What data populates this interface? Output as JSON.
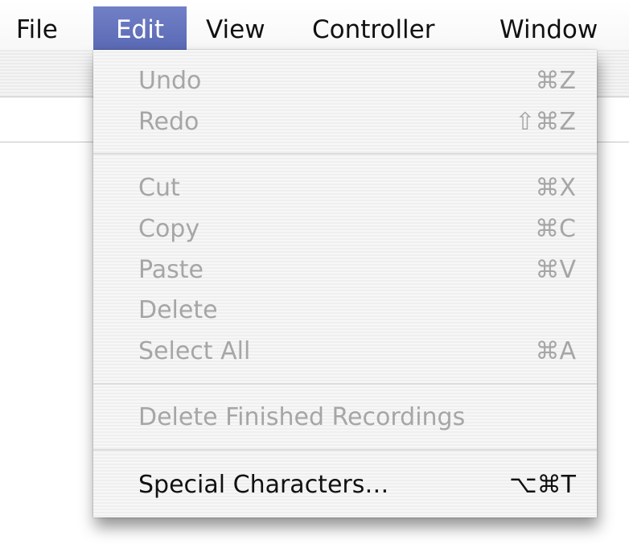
{
  "menubar": {
    "items": [
      {
        "label": "File"
      },
      {
        "label": "Edit"
      },
      {
        "label": "View"
      },
      {
        "label": "Controller"
      },
      {
        "label": "Window"
      }
    ],
    "selected": "Edit"
  },
  "edit_menu": {
    "items": [
      {
        "label": "Undo",
        "shortcut": "⌘Z",
        "enabled": false
      },
      {
        "label": "Redo",
        "shortcut": "⇧⌘Z",
        "enabled": false
      },
      {
        "label": "Cut",
        "shortcut": "⌘X",
        "enabled": false
      },
      {
        "label": "Copy",
        "shortcut": "⌘C",
        "enabled": false
      },
      {
        "label": "Paste",
        "shortcut": "⌘V",
        "enabled": false
      },
      {
        "label": "Delete",
        "shortcut": "",
        "enabled": false
      },
      {
        "label": "Select All",
        "shortcut": "⌘A",
        "enabled": false
      },
      {
        "label": "Delete Finished Recordings",
        "shortcut": "",
        "enabled": false
      },
      {
        "label": "Special Characters…",
        "shortcut": "⌥⌘T",
        "enabled": true
      }
    ]
  },
  "colors": {
    "selection": "#6575be",
    "disabled_text": "#a6a6a6",
    "enabled_text": "#111111"
  }
}
